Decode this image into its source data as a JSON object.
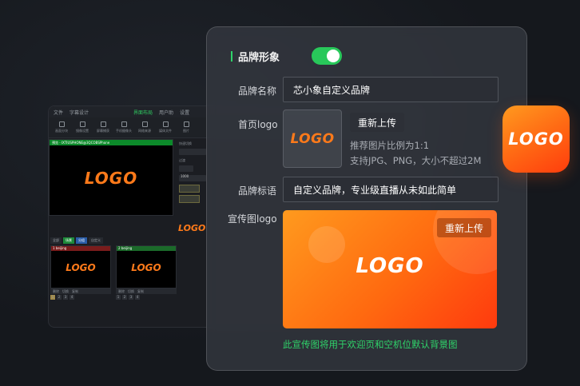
{
  "app": {
    "menu": [
      "文件",
      "字幕设计",
      "界面布局",
      "用户助",
      "设置"
    ],
    "tools": [
      "画面分块",
      "镜像设置",
      "屏幕捕获",
      "手机摄像头",
      "网络来源",
      "媒体文件",
      "图片"
    ],
    "preview_header": "预览 - IXTIUSPHONE@3QCOBSPhone",
    "preview_logo": "LOGO",
    "side_label_1": "快速切换",
    "side_label_2": "过渡",
    "side_value": "1000",
    "mid_logo": "LOGO",
    "scene_tabs": [
      "全部",
      "场景",
      "分组",
      "自定义"
    ],
    "scenes": [
      {
        "title": "1 beijing",
        "logo": "LOGO"
      },
      {
        "title": "2 beijing",
        "logo": "LOGO"
      }
    ],
    "scene_controls": [
      "删除",
      "切换",
      "复制"
    ],
    "scene_numbers": [
      "1",
      "2",
      "3",
      "4"
    ]
  },
  "card": {
    "title": "品牌形象",
    "toggle_on": true,
    "brand_name_label": "品牌名称",
    "brand_name_value": "芯小象自定义品牌",
    "homepage_logo_label": "首页logo",
    "homepage_logo_text": "LOGO",
    "reupload_label": "重新上传",
    "hint_ratio": "推荐图片比例为1:1",
    "hint_format": "支持JPG、PNG，大小不超过2M",
    "slogan_label": "品牌标语",
    "slogan_value": "自定义品牌，专业级直播从未如此简单",
    "banner_label": "宣传图logo",
    "banner_logo_text": "LOGO",
    "banner_reupload_label": "重新上传",
    "banner_note": "此宣传图将用于欢迎页和空机位默认背景图"
  },
  "app_icon": {
    "text": "LOGO"
  },
  "colors": {
    "accent_green": "#2fd46a",
    "logo_orange": "#ff7a1a",
    "card_bg": "#343840"
  }
}
